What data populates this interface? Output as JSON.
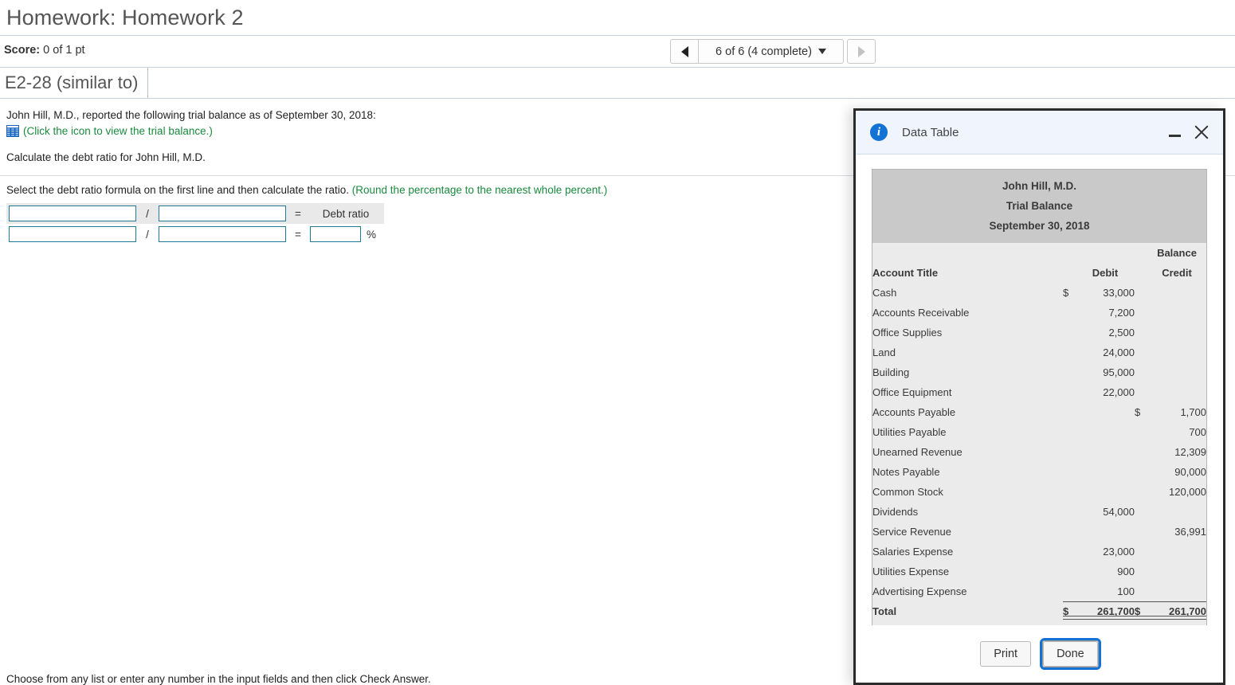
{
  "header": {
    "title": "Homework: Homework 2",
    "score_label": "Score:",
    "score_value": "0 of 1 pt",
    "exercise_tab": "E2-28 (similar to)"
  },
  "pager": {
    "prev_icon": "triangle-left-icon",
    "next_icon": "triangle-right-icon",
    "selected": "6 of 6 (4 complete)",
    "caret_icon": "caret-down-icon"
  },
  "question": {
    "intro": "John Hill, M.D., reported the following trial balance as of September 30, 2018:",
    "icon_name": "grid-table-icon",
    "icon_link": "(Click the icon to view the trial balance.)",
    "calculate": "Calculate the debt ratio for John Hill, M.D.",
    "instruction_main": "Select the debt ratio formula on the first line and then calculate the ratio.",
    "instruction_green": "(Round the percentage to the nearest whole percent.)",
    "bottom_note": "Choose from any list or enter any number in the input fields and then click Check Answer."
  },
  "answer": {
    "row1": {
      "numerator": "",
      "divider": "/",
      "denominator": "",
      "equals": "=",
      "label": "Debt ratio"
    },
    "row2": {
      "numerator": "",
      "divider": "/",
      "denominator": "",
      "equals": "=",
      "result": "",
      "unit": "%"
    }
  },
  "dialog": {
    "icon_name": "info-icon",
    "title": "Data Table",
    "minimize_icon": "minimize-icon",
    "close_icon": "close-icon",
    "buttons": {
      "print": "Print",
      "done": "Done"
    }
  },
  "trial_balance": {
    "company": "John Hill, M.D.",
    "statement": "Trial Balance",
    "date": "September 30, 2018",
    "balance_header": "Balance",
    "col_account": "Account Title",
    "col_debit": "Debit",
    "col_credit": "Credit",
    "currency_symbol": "$",
    "rows": [
      {
        "account": "Cash",
        "debit_sign": "$",
        "debit": "33,000",
        "credit_sign": "",
        "credit": ""
      },
      {
        "account": "Accounts Receivable",
        "debit_sign": "",
        "debit": "7,200",
        "credit_sign": "",
        "credit": ""
      },
      {
        "account": "Office Supplies",
        "debit_sign": "",
        "debit": "2,500",
        "credit_sign": "",
        "credit": ""
      },
      {
        "account": "Land",
        "debit_sign": "",
        "debit": "24,000",
        "credit_sign": "",
        "credit": ""
      },
      {
        "account": "Building",
        "debit_sign": "",
        "debit": "95,000",
        "credit_sign": "",
        "credit": ""
      },
      {
        "account": "Office Equipment",
        "debit_sign": "",
        "debit": "22,000",
        "credit_sign": "",
        "credit": ""
      },
      {
        "account": "Accounts Payable",
        "debit_sign": "",
        "debit": "",
        "credit_sign": "$",
        "credit": "1,700"
      },
      {
        "account": "Utilities Payable",
        "debit_sign": "",
        "debit": "",
        "credit_sign": "",
        "credit": "700"
      },
      {
        "account": "Unearned Revenue",
        "debit_sign": "",
        "debit": "",
        "credit_sign": "",
        "credit": "12,309"
      },
      {
        "account": "Notes Payable",
        "debit_sign": "",
        "debit": "",
        "credit_sign": "",
        "credit": "90,000"
      },
      {
        "account": "Common Stock",
        "debit_sign": "",
        "debit": "",
        "credit_sign": "",
        "credit": "120,000"
      },
      {
        "account": "Dividends",
        "debit_sign": "",
        "debit": "54,000",
        "credit_sign": "",
        "credit": ""
      },
      {
        "account": "Service Revenue",
        "debit_sign": "",
        "debit": "",
        "credit_sign": "",
        "credit": "36,991"
      },
      {
        "account": "Salaries Expense",
        "debit_sign": "",
        "debit": "23,000",
        "credit_sign": "",
        "credit": ""
      },
      {
        "account": "Utilities Expense",
        "debit_sign": "",
        "debit": "900",
        "credit_sign": "",
        "credit": ""
      },
      {
        "account": "Advertising Expense",
        "debit_sign": "",
        "debit": "100",
        "credit_sign": "",
        "credit": ""
      }
    ],
    "total": {
      "label": "Total",
      "debit_sign": "$",
      "debit": "261,700",
      "credit_sign": "$",
      "credit": "261,700"
    }
  }
}
